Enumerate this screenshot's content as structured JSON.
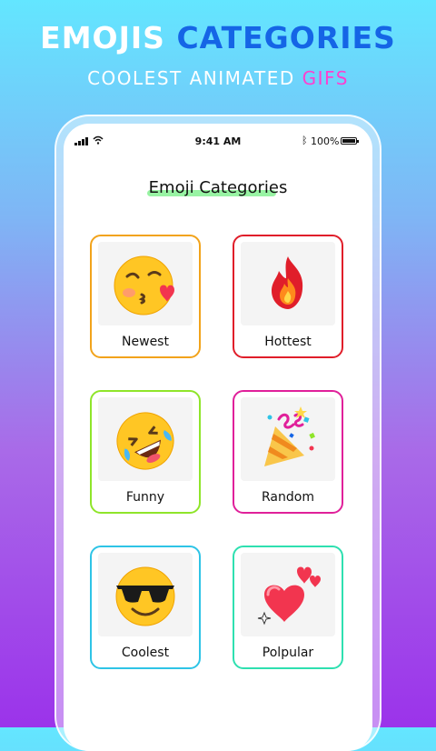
{
  "promo": {
    "headline_part1": "EMOJIS",
    "headline_part2": "CATEGORIES",
    "subline_part1": "COOLEST ANIMATED",
    "subline_part2": "GIFS"
  },
  "status_bar": {
    "time": "9:41 AM",
    "battery_text": "100%"
  },
  "screen": {
    "title": "Emoji Categories"
  },
  "categories": [
    {
      "label": "Newest",
      "icon": "kissing-face-icon",
      "border_color": "#f2a31b"
    },
    {
      "label": "Hottest",
      "icon": "fire-icon",
      "border_color": "#e01e2a"
    },
    {
      "label": "Funny",
      "icon": "rolling-laughing-face-icon",
      "border_color": "#8fe52a"
    },
    {
      "label": "Random",
      "icon": "party-popper-icon",
      "border_color": "#e0209a"
    },
    {
      "label": "Coolest",
      "icon": "sunglasses-face-icon",
      "border_color": "#2ec4e6"
    },
    {
      "label": "Polpular",
      "icon": "hearts-icon",
      "border_color": "#2ee0b0"
    }
  ]
}
